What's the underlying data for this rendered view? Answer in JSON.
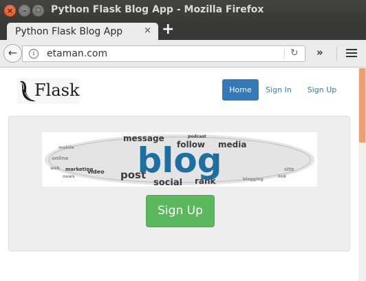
{
  "window": {
    "title": "Python Flask Blog App - Mozilla Firefox",
    "controls": {
      "close": "×",
      "minimize": "–",
      "maximize": "□"
    }
  },
  "tabs": [
    {
      "label": "Python Flask Blog App",
      "close": "×",
      "active": true
    }
  ],
  "tabstrip": {
    "new_tab": "+"
  },
  "navbar": {
    "back": "←",
    "url": "etaman.com",
    "info": "i",
    "reload": "↻",
    "overflow": "»"
  },
  "page": {
    "logo_text": "Flask",
    "nav": [
      {
        "label": "Home",
        "active": true
      },
      {
        "label": "Sign In",
        "active": false
      },
      {
        "label": "Sign Up",
        "active": false
      }
    ],
    "banner": {
      "main_word": "blog",
      "words": [
        "message",
        "follow",
        "media",
        "post",
        "social",
        "rank",
        "podcast",
        "marketing",
        "video"
      ]
    },
    "cta_label": "Sign Up"
  },
  "colors": {
    "primary": "#337ab7",
    "success": "#5cb85c",
    "jumbotron": "#eeeeee",
    "titlebar": "#3c3c38",
    "scroll_thumb": "#ef9f6f"
  }
}
